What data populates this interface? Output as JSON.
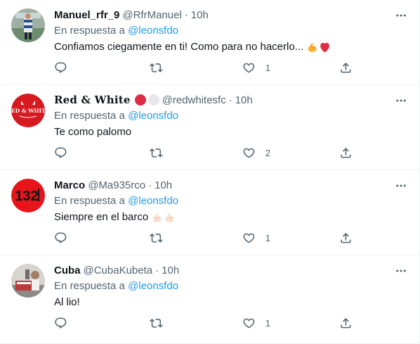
{
  "tweets": [
    {
      "name": "Manuel_rfr_9",
      "handle": "@RfrManuel",
      "separator": "·",
      "time": "10h",
      "reply_prefix": "En respuesta a",
      "reply_to": "@leonsfdo",
      "text": "Confiamos ciegamente en ti! Como para no hacerlo...",
      "emojis": [
        "flexed-biceps",
        "red-heart"
      ],
      "replies": "",
      "retweets": "",
      "likes": "1"
    },
    {
      "name": "Red & White",
      "handle": "@redwhitesfc",
      "separator": "·",
      "time": "10h",
      "reply_prefix": "En respuesta a",
      "reply_to": "@leonsfdo",
      "text": "Te como palomo",
      "emojis": [],
      "badges": [
        "red-circle",
        "white-circle"
      ],
      "replies": "",
      "retweets": "",
      "likes": "2"
    },
    {
      "name": "Marco",
      "handle": "@Ma935rco",
      "separator": "·",
      "time": "10h",
      "reply_prefix": "En respuesta a",
      "reply_to": "@leonsfdo",
      "text": "Siempre en el barco",
      "emojis": [
        "flexed-biceps-light",
        "flexed-biceps-light"
      ],
      "replies": "",
      "retweets": "",
      "likes": "1"
    },
    {
      "name": "Cuba",
      "handle": "@CubaKubeta",
      "separator": "·",
      "time": "10h",
      "reply_prefix": "En respuesta a",
      "reply_to": "@leonsfdo",
      "text": "Al lio!",
      "emojis": [],
      "replies": "",
      "retweets": "",
      "likes": "1"
    }
  ],
  "avatar_labels": {
    "red_white_logo": "RED & WHITE",
    "marco_logo": "132"
  },
  "colors": {
    "link": "#1d9bf0",
    "secondary": "#536471",
    "primary": "#0f1419",
    "divider": "#eff3f4"
  }
}
